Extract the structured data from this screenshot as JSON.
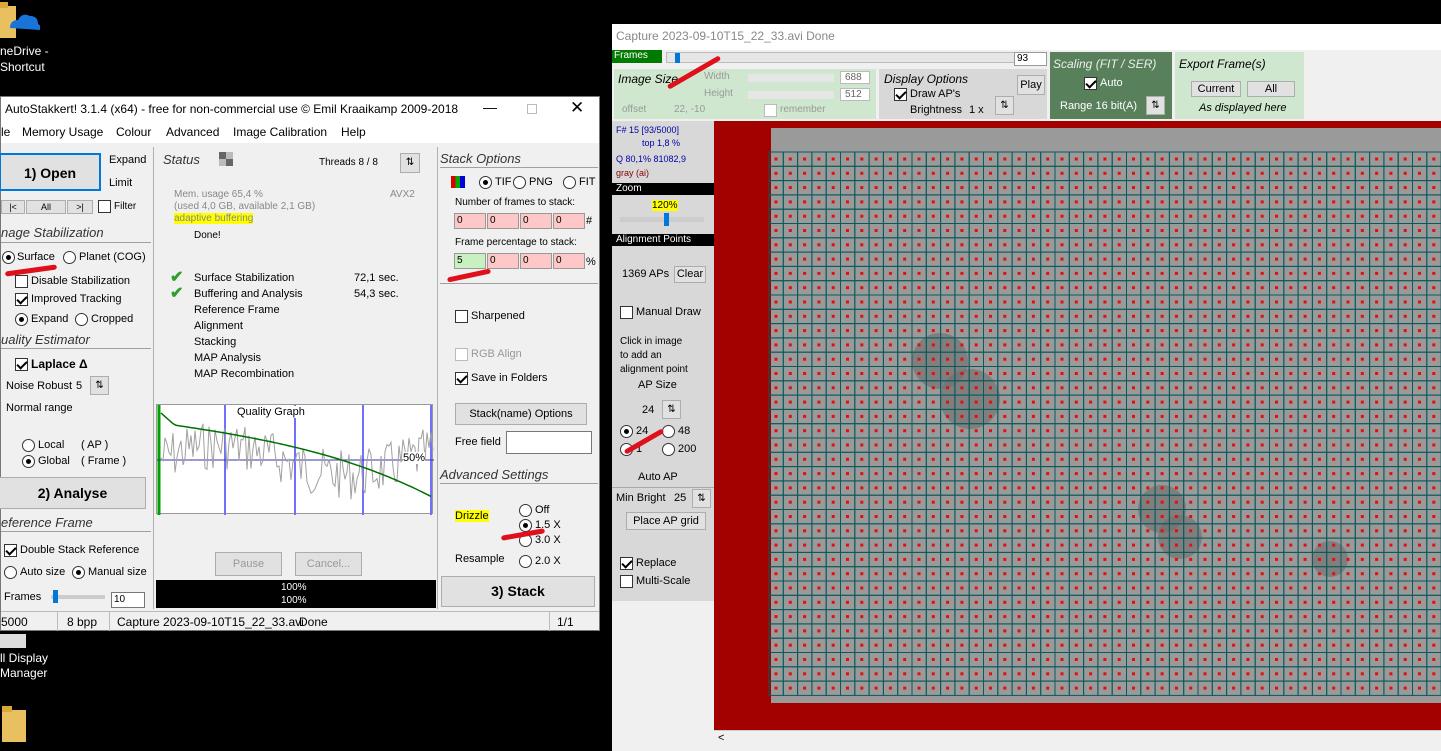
{
  "desktop": {
    "onedrive_label": [
      "neDrive -",
      "Shortcut"
    ],
    "display_label": [
      "ll Display",
      "Manager"
    ]
  },
  "autostakkert": {
    "title": "AutoStakkert! 3.1.4 (x64) - free for non-commercial use © Emil Kraaikamp 2009-2018",
    "menu": [
      "le",
      "Memory Usage",
      "Colour",
      "Advanced",
      "Image Calibration",
      "Help"
    ],
    "open_label": "1) Open",
    "expand": "Expand",
    "limit": "Limit",
    "nav": [
      "|<",
      "All",
      ">|"
    ],
    "filter": "Filter",
    "stab_head": "nage Stabilization",
    "surface": "Surface",
    "planet": "Planet (COG)",
    "disable_stab": "Disable Stabilization",
    "improved_tracking": "Improved Tracking",
    "expand_opt": "Expand",
    "cropped": "Cropped",
    "quality_head": "uality Estimator",
    "laplace": "Laplace Δ",
    "noise_robust": "Noise Robust",
    "noise_value": "5",
    "normal_range": "Normal range",
    "local": "Local",
    "local_ap": "( AP )",
    "global": "Global",
    "global_frame": "( Frame )",
    "analyse_label": "2) Analyse",
    "ref_head": "eference Frame",
    "double_stack": "Double Stack Reference",
    "auto_size": "Auto size",
    "manual_size": "Manual size",
    "frames": "Frames",
    "frames_value": "10",
    "status_head": "Status",
    "threads": "Threads 8 / 8",
    "mem_usage": "Mem. usage 65,4 %",
    "mem_detail": "(used 4,0 GB, available 2,1 GB)",
    "avx": "AVX2",
    "adaptive": "adaptive buffering",
    "done": "Done!",
    "steps": [
      {
        "name": "Surface Stabilization",
        "time": "72,1 sec."
      },
      {
        "name": "Buffering and Analysis",
        "time": "54,3 sec."
      },
      {
        "name": "Reference Frame",
        "time": ""
      },
      {
        "name": "Alignment",
        "time": ""
      },
      {
        "name": "Stacking",
        "time": ""
      },
      {
        "name": "MAP Analysis",
        "time": ""
      },
      {
        "name": "MAP Recombination",
        "time": ""
      }
    ],
    "graph_title": "Quality Graph",
    "graph_pct": "50%",
    "pause": "Pause",
    "cancel": "Cancel...",
    "progress1": "100%",
    "progress2": "100%",
    "stack_head": "Stack Options",
    "tif": "TIF",
    "png": "PNG",
    "fit": "FIT",
    "num_frames_label": "Number of frames to stack:",
    "num_frames": [
      "0",
      "0",
      "0",
      "0"
    ],
    "hash": "#",
    "pct_label": "Frame percentage to stack:",
    "pct": [
      "5",
      "0",
      "0",
      "0"
    ],
    "pct_sign": "%",
    "sharpened": "Sharpened",
    "rgb_align": "RGB Align",
    "save_folders": "Save in Folders",
    "stackname_btn": "Stack(name) Options",
    "free_field": "Free field",
    "adv_head": "Advanced Settings",
    "drizzle": "Drizzle",
    "off": "Off",
    "x15": "1.5 X",
    "x30": "3.0 X",
    "resample": "Resample",
    "x20": "2.0 X",
    "stack_label": "3) Stack",
    "status_bar": [
      "5000",
      "8 bpp",
      "Capture 2023-09-10T15_22_33.avi",
      "Done",
      "1/1"
    ]
  },
  "viewer": {
    "title": "Capture 2023-09-10T15_22_33.avi   Done",
    "frames_label": "Frames",
    "frame_value": "93",
    "image_size": "Image Size",
    "width": "Width",
    "width_val": "688",
    "height": "Height",
    "height_val": "512",
    "offset": "offset",
    "offset_val": "22, -10",
    "remember": "remember",
    "display_options": "Display Options",
    "draw_aps": "Draw AP's",
    "brightness": "Brightness",
    "brightness_val": "1 x",
    "play": "Play",
    "scaling": "Scaling (FIT / SER)",
    "auto": "Auto",
    "range": "Range 16 bit(A)",
    "export": "Export Frame(s)",
    "current": "Current",
    "all": "All",
    "as_displayed": "As displayed here",
    "frame_info": "F# 15 [93/5000]",
    "top": "top 1,8 %",
    "q_info": "Q 80,1%  81082,9",
    "gray": "gray (ai)",
    "zoom": "Zoom",
    "zoom_val": "120%",
    "align_points": "Alignment Points",
    "aps_count": "1369 APs",
    "clear": "Clear",
    "manual_draw": "Manual Draw",
    "click_info": [
      "Click in image",
      "to add an",
      "alignment point"
    ],
    "ap_size": "AP Size",
    "ap_size_val": "24",
    "ap24": "24",
    "ap48": "48",
    "ap1x": "1",
    "ap200": "200",
    "auto_ap": "Auto AP",
    "min_bright": "Min Bright",
    "min_bright_val": "25",
    "place_grid": "Place AP grid",
    "replace": "Replace",
    "multi_scale": "Multi-Scale"
  },
  "colors": {
    "red_border": "#a30000",
    "grid_line": "#0a5a5a",
    "ap_dot": "#e01010",
    "green_header": "#cfe7cf",
    "dark_green": "#58805a"
  }
}
